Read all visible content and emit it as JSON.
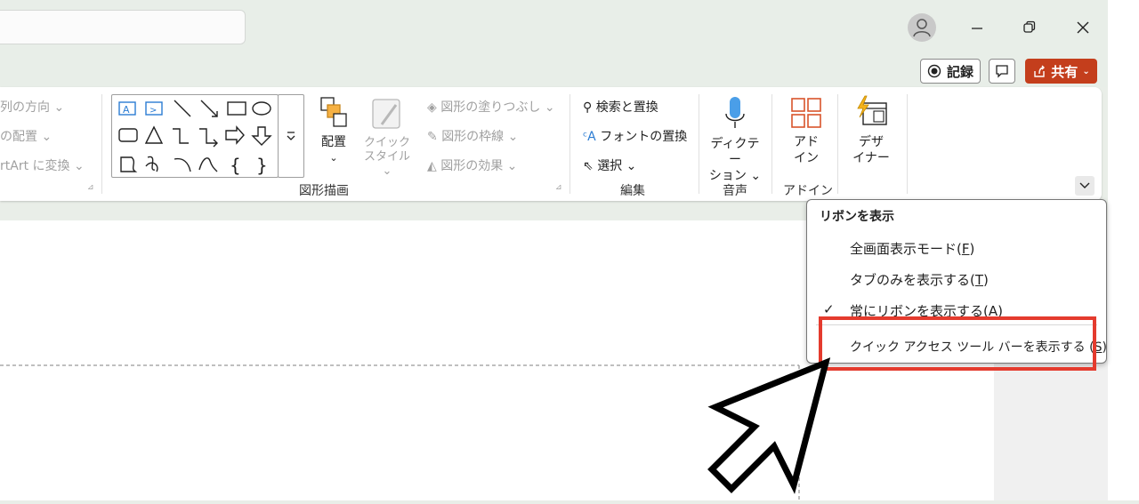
{
  "titlebar": {
    "record_label": "記録",
    "share_label": "共有"
  },
  "ribbon": {
    "arrange_group": {
      "direction": "列の方向",
      "align": "の配置",
      "smartart": "rtArt に変換"
    },
    "drawing_group": {
      "title": "図形描画",
      "arrange_btn": "配置",
      "quick_style_line1": "クイック",
      "quick_style_line2": "スタイル",
      "fill": "図形の塗りつぶし",
      "outline": "図形の枠線",
      "effects": "図形の効果"
    },
    "edit_group": {
      "title": "編集",
      "find_replace": "検索と置換",
      "font_replace": "フォントの置換",
      "select": "選択"
    },
    "voice_group": {
      "title": "音声",
      "dictate_line1": "ディクテー",
      "dictate_line2": "ション"
    },
    "addin_group": {
      "title": "アドイン",
      "addin_line1": "アド",
      "addin_line2": "イン"
    },
    "designer": {
      "line1": "デザ",
      "line2": "イナー"
    }
  },
  "menu": {
    "title": "リボンを表示",
    "items": [
      {
        "text": "全画面表示モード(",
        "key": "F",
        "end": ")"
      },
      {
        "text": "タブのみを表示する(",
        "key": "T",
        "end": ")"
      },
      {
        "text": "常にリボンを表示する(A)",
        "key": "",
        "end": ""
      },
      {
        "text": "クイック アクセス ツール バーを表示する (",
        "key": "S",
        "end": ")"
      }
    ]
  },
  "colors": {
    "accent": "#c43e1c",
    "highlight": "#e43b2e"
  }
}
